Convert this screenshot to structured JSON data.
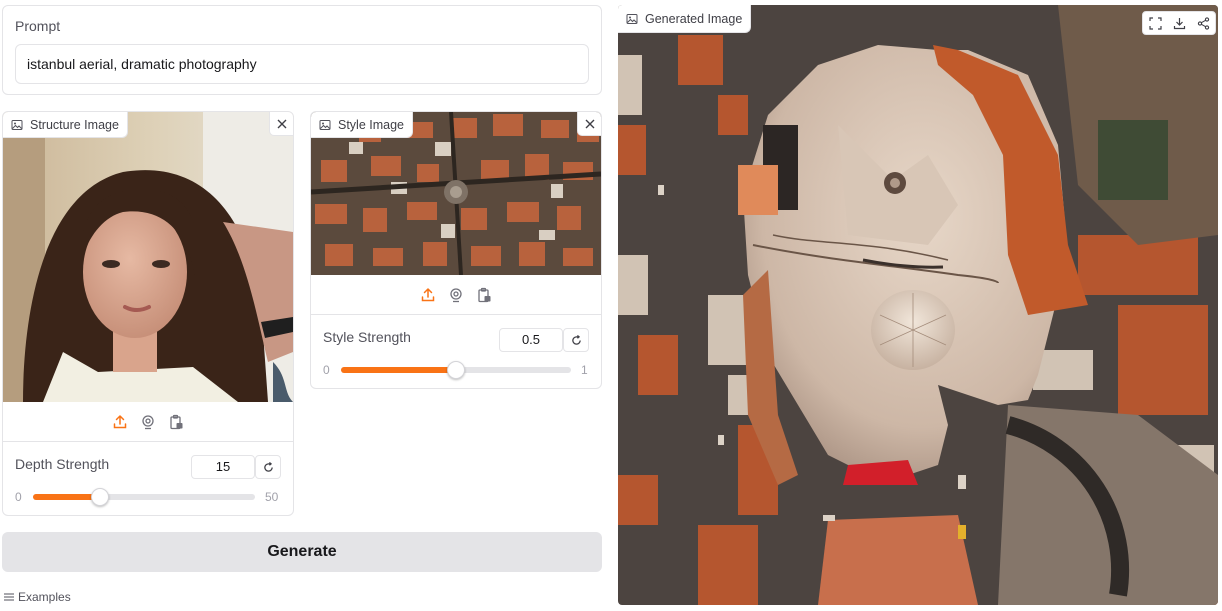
{
  "prompt": {
    "label": "Prompt",
    "value": "istanbul aerial, dramatic photography"
  },
  "structure_image": {
    "label": "Structure Image",
    "depth": {
      "label": "Depth Strength",
      "value": "15",
      "min": "0",
      "max": "50",
      "fraction": 0.3
    }
  },
  "style_image": {
    "label": "Style Image",
    "strength": {
      "label": "Style Strength",
      "value": "0.5",
      "min": "0",
      "max": "1",
      "fraction": 0.5
    }
  },
  "generate_button": "Generate",
  "examples_label": "Examples",
  "output": {
    "label": "Generated Image"
  },
  "colors": {
    "accent": "#f97316",
    "button_bg": "#e4e4e7",
    "border": "#e4e4e7"
  },
  "icons": [
    "image-icon",
    "close-icon",
    "upload-icon",
    "webcam-icon",
    "clipboard-icon",
    "reset-icon",
    "fullscreen-icon",
    "download-icon",
    "share-icon",
    "list-icon"
  ]
}
